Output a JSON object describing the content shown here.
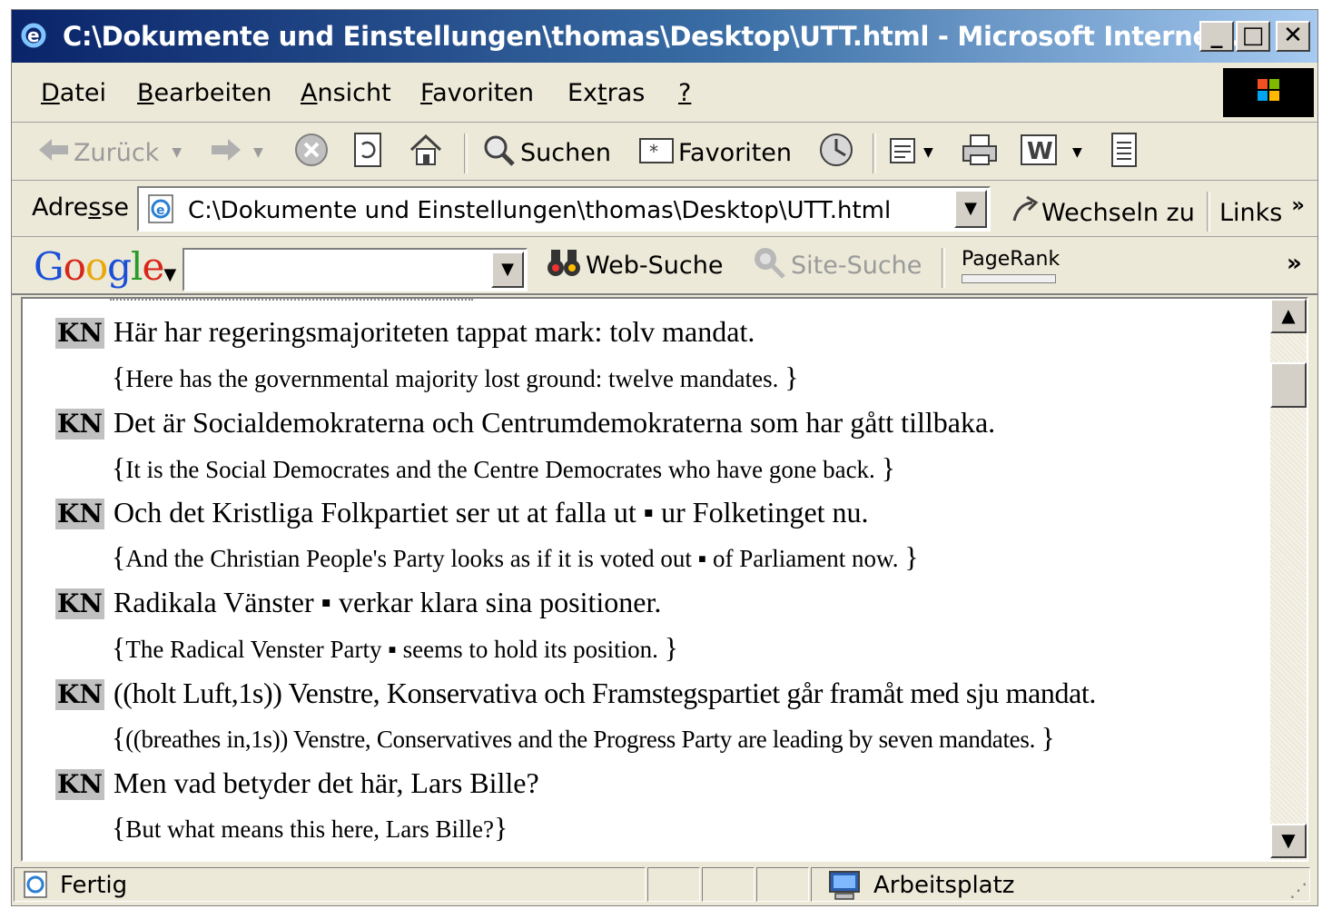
{
  "window": {
    "title": "C:\\Dokumente und Einstellungen\\thomas\\Desktop\\UTT.html - Microsoft Internet ...",
    "buttons": {
      "minimize": "_",
      "maximize": "□",
      "close": "✕"
    }
  },
  "menu": {
    "items": [
      {
        "label": "Datei",
        "ul": "D",
        "rest": "atei"
      },
      {
        "label": "Bearbeiten",
        "ul": "B",
        "rest": "earbeiten"
      },
      {
        "label": "Ansicht",
        "ul": "A",
        "rest": "nsicht"
      },
      {
        "label": "Favoriten",
        "ul": "F",
        "rest": "avoriten"
      },
      {
        "pre": "Ex",
        "ul": "t",
        "rest": "ras"
      },
      {
        "label": "?",
        "ul": "?",
        "rest": ""
      }
    ]
  },
  "toolbar": {
    "back_label": "Zurück",
    "search_label": "Suchen",
    "favorites_label": "Favoriten"
  },
  "address": {
    "label_pre": "Adre",
    "label_ul": "s",
    "label_post": "se",
    "value": "C:\\Dokumente und Einstellungen\\thomas\\Desktop\\UTT.html",
    "go_label": "Wechseln zu",
    "links_label": "Links",
    "more": "»"
  },
  "googlebar": {
    "logo": "Google",
    "search_value": "",
    "web_search_label": "Web-Suche",
    "site_search_label": "Site-Suche",
    "pagerank_label": "PageRank",
    "more": "»"
  },
  "transcript": [
    {
      "speaker": "KN",
      "original": "Här har regeringsmajoriteten tappat mark: tolv mandat.",
      "translation": "Here has the governmental majority lost ground: twelve mandates. "
    },
    {
      "speaker": "KN",
      "original": "Det är Socialdemokraterna och Centrumdemokraterna som har gått tillbaka.",
      "translation": "It is the Social Democrates and the Centre Democrates who have gone back. "
    },
    {
      "speaker": "KN",
      "original": "Och det Kristliga Folkpartiet ser ut at falla ut ▪ ur Folketinget nu.",
      "translation": "And the Christian People's Party looks as if it is voted out ▪ of Parliament now. "
    },
    {
      "speaker": "KN",
      "original": "Radikala Vänster ▪ verkar klara sina positioner.",
      "translation": "The Radical Venster Party ▪ seems to hold its position. "
    },
    {
      "speaker": "KN",
      "original": "((holt Luft,1s)) Venstre, Konservativa och Framstegspartiet går framåt med sju mandat.",
      "translation": "((breathes in,1s)) Venstre, Conservatives and the Progress Party are leading by seven mandates. "
    },
    {
      "speaker": "KN",
      "original": "Men vad betyder det här, Lars Bille?",
      "translation": "But what means this here, Lars Bille?"
    }
  ],
  "status": {
    "text": "Fertig",
    "zone": "Arbeitsplatz"
  }
}
